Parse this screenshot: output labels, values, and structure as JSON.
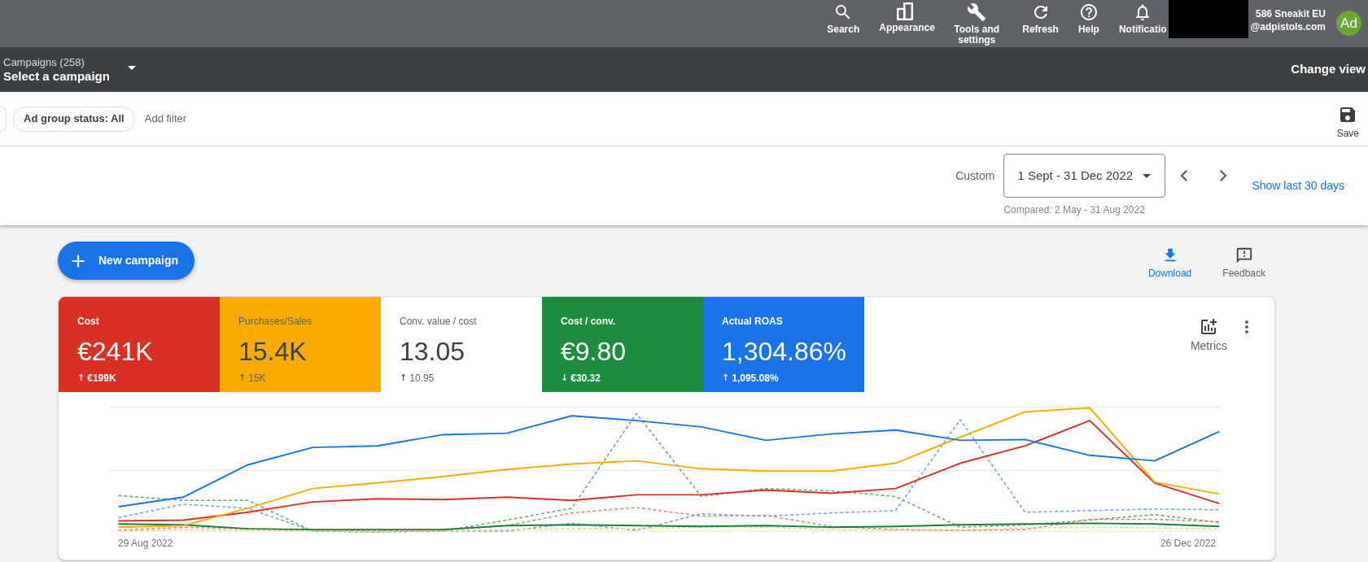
{
  "top_bar": {
    "actions": [
      {
        "label": "Search"
      },
      {
        "label": "Appearance"
      },
      {
        "label": "Tools and settings"
      },
      {
        "label": "Refresh"
      },
      {
        "label": "Help"
      },
      {
        "label": "Notificatio"
      }
    ],
    "account": {
      "name": "586 Sneakit EU",
      "email": "@adpistols.com",
      "avatar": "Ad"
    }
  },
  "campaign_bar": {
    "label": "Campaigns (258)",
    "value": "Select a campaign",
    "change_view": "Change view"
  },
  "filter_bar": {
    "chips": [
      "Ad group status: All"
    ],
    "add_filter": "Add filter",
    "save": "Save"
  },
  "date_bar": {
    "label": "Custom",
    "range": "1 Sept - 31 Dec 2022",
    "compared": "Compared: 2 May - 31 Aug 2022",
    "show_last": "Show last 30 days"
  },
  "actions": {
    "new_campaign": "New campaign",
    "download": "Download",
    "feedback": "Feedback"
  },
  "metrics": [
    {
      "label": "Cost",
      "value": "€241K",
      "arrow": "↑",
      "change": "€199K",
      "selected": true,
      "color": "#d93025"
    },
    {
      "label": "Purchases/Sales",
      "value": "15.4K",
      "arrow": "↑",
      "change": "15K",
      "selected": true,
      "color": "#f9ab00"
    },
    {
      "label": "Conv. value / cost",
      "value": "13.05",
      "arrow": "↑",
      "change": "10.95",
      "selected": false
    },
    {
      "label": "Cost / conv.",
      "value": "€9.80",
      "arrow": "↓",
      "change": "€30.32",
      "selected": true,
      "color": "#1e8e3e"
    },
    {
      "label": "Actual ROAS",
      "value": "1,304.86%",
      "arrow": "↑",
      "change": "1,095.08%",
      "selected": true,
      "color": "#1a73e8"
    }
  ],
  "metrics_button": "Metrics",
  "chart": {
    "start_label": "29 Aug 2022",
    "end_label": "26 Dec 2022"
  }
}
